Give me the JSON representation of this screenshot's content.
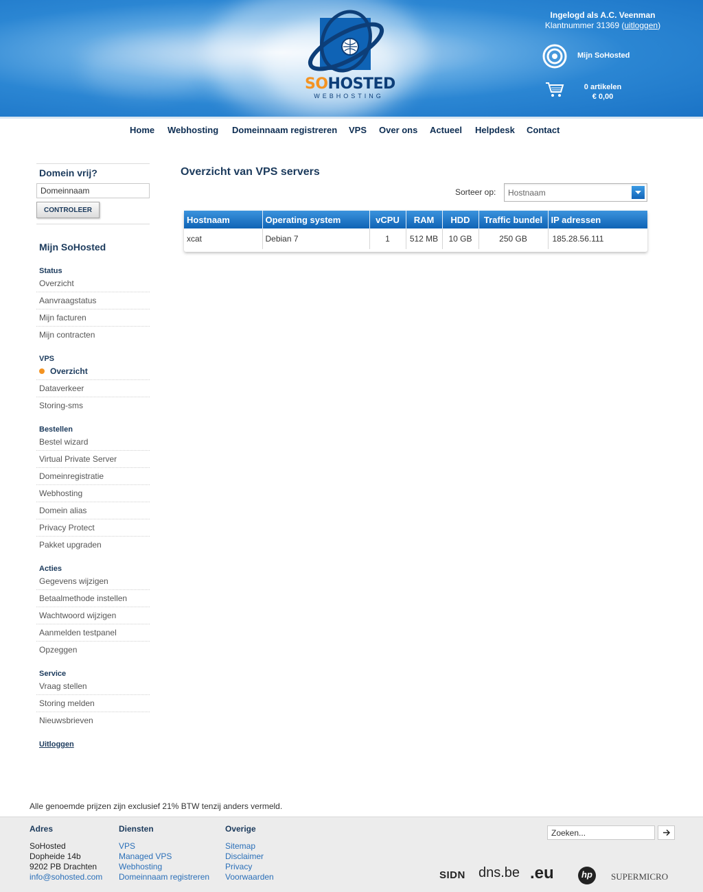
{
  "header": {
    "logo": {
      "so": "SO",
      "hosted": "HOSTED",
      "sub": "WEBHOSTING"
    },
    "login_line1": "Ingelogd als A.C. Veenman",
    "login_line2": "Klantnummer 31369",
    "logout_link": "uitloggen",
    "mijn_sohosted": "Mijn SoHosted",
    "cart_items": "0 artikelen",
    "cart_total": "€ 0,00"
  },
  "nav": [
    "Home",
    "Webhosting",
    "Domeinnaam registreren",
    "VPS",
    "Over ons",
    "Actueel",
    "Helpdesk",
    "Contact"
  ],
  "sidebar": {
    "domain_title": "Domein vrij?",
    "domain_value": "Domeinnaam",
    "check_button": "CONTROLEER",
    "mijn_title": "Mijn SoHosted",
    "sections": [
      {
        "title": "Status",
        "items": [
          "Overzicht",
          "Aanvraagstatus",
          "Mijn facturen",
          "Mijn contracten"
        ]
      },
      {
        "title": "VPS",
        "items": [
          "Overzicht",
          "Dataverkeer",
          "Storing-sms"
        ],
        "active": "Overzicht"
      },
      {
        "title": "Bestellen",
        "items": [
          "Bestel wizard",
          "Virtual Private Server",
          "Domeinregistratie",
          "Webhosting",
          "Domein alias",
          "Privacy Protect",
          "Pakket upgraden"
        ]
      },
      {
        "title": "Acties",
        "items": [
          "Gegevens wijzigen",
          "Betaalmethode instellen",
          "Wachtwoord wijzigen",
          "Aanmelden testpanel",
          "Opzeggen"
        ]
      },
      {
        "title": "Service",
        "items": [
          "Vraag stellen",
          "Storing melden",
          "Nieuwsbrieven"
        ]
      }
    ],
    "logout": "Uitloggen"
  },
  "main": {
    "title": "Overzicht van VPS servers",
    "sort_label": "Sorteer op:",
    "sort_value": "Hostnaam",
    "table": {
      "headers": [
        "Hostnaam",
        "Operating system",
        "vCPU",
        "RAM",
        "HDD",
        "Traffic bundel",
        "IP adressen"
      ],
      "rows": [
        [
          "xcat",
          "Debian 7",
          "1",
          "512 MB",
          "10 GB",
          "250 GB",
          "185.28.56.111"
        ]
      ]
    }
  },
  "footer": {
    "disclaimer": "Alle genoemde prijzen zijn exclusief 21% BTW tenzij anders vermeld.",
    "adres": {
      "title": "Adres",
      "lines": [
        "SoHosted",
        "Dopheide 14b",
        "9202 PB Drachten"
      ],
      "email": "info@sohosted.com"
    },
    "diensten": {
      "title": "Diensten",
      "links": [
        "VPS",
        "Managed VPS",
        "Webhosting",
        "Domeinnaam registreren"
      ]
    },
    "overige": {
      "title": "Overige",
      "links": [
        "Sitemap",
        "Disclaimer",
        "Privacy",
        "Voorwaarden"
      ]
    },
    "search_placeholder": "Zoeken...",
    "partners": {
      "sidn": "SIDN",
      "dnsbe": "dns.be",
      "eu": ".eu",
      "hp": "hp",
      "supermicro": "SUPERMICRO"
    }
  }
}
